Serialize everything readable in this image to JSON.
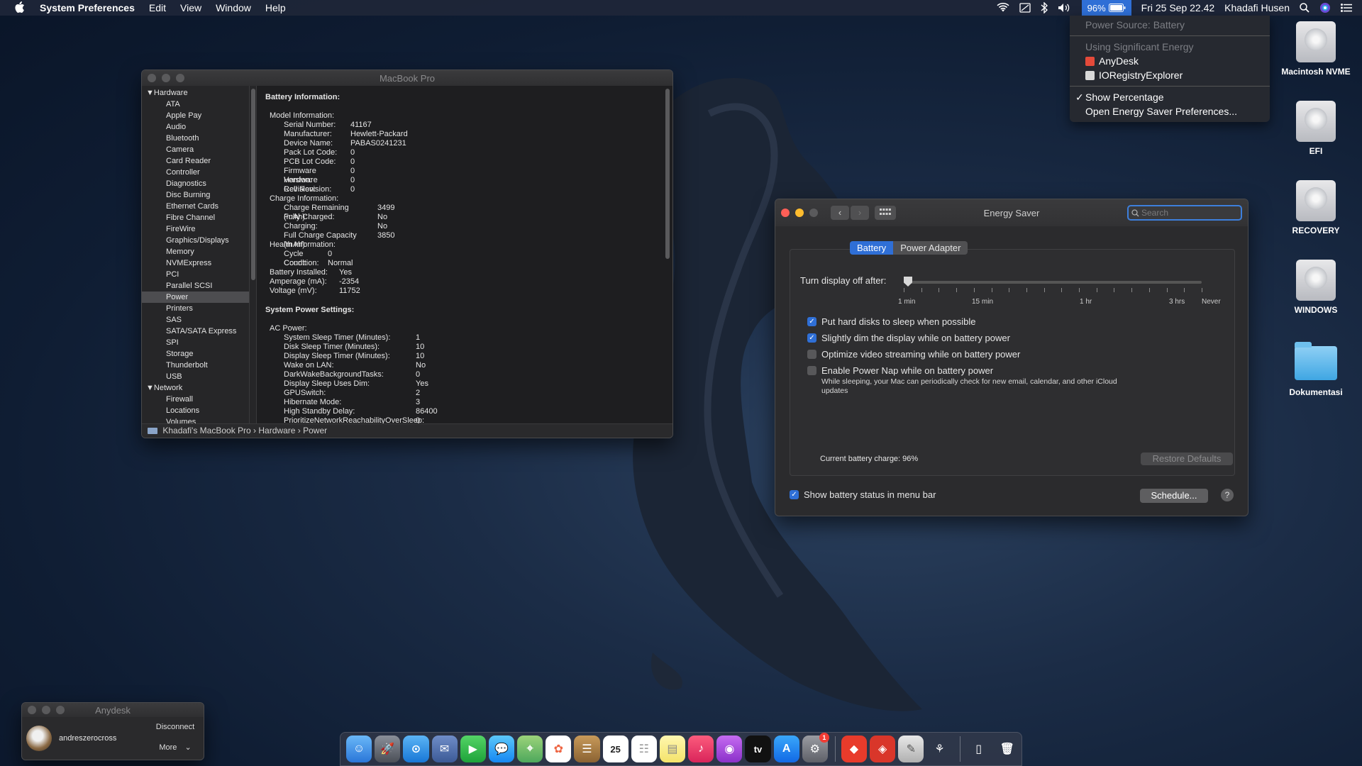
{
  "menubar": {
    "app": "System Preferences",
    "menus": [
      "Edit",
      "View",
      "Window",
      "Help"
    ],
    "battery_percent": "96%",
    "datetime": "Fri 25 Sep  22.42",
    "user": "Khadafi Husen"
  },
  "battery_menu": {
    "power_source": "Power Source: Battery",
    "sig_energy_header": "Using Significant Energy",
    "apps": [
      "AnyDesk",
      "IORegistryExplorer"
    ],
    "show_percentage": "Show Percentage",
    "open_prefs": "Open Energy Saver Preferences..."
  },
  "desktop_icons": [
    "Macintosh NVME",
    "EFI",
    "RECOVERY",
    "WINDOWS",
    "Dokumentasi"
  ],
  "sysinfo": {
    "title": "MacBook Pro",
    "sidebar": {
      "hardware_label": "Hardware",
      "hardware_items": [
        "ATA",
        "Apple Pay",
        "Audio",
        "Bluetooth",
        "Camera",
        "Card Reader",
        "Controller",
        "Diagnostics",
        "Disc Burning",
        "Ethernet Cards",
        "Fibre Channel",
        "FireWire",
        "Graphics/Displays",
        "Memory",
        "NVMExpress",
        "PCI",
        "Parallel SCSI",
        "Power",
        "Printers",
        "SAS",
        "SATA/SATA Express",
        "SPI",
        "Storage",
        "Thunderbolt",
        "USB"
      ],
      "network_label": "Network",
      "network_items": [
        "Firewall",
        "Locations",
        "Volumes"
      ]
    },
    "battery_info_title": "Battery Information:",
    "model_info_label": "Model Information:",
    "model_rows": [
      [
        "Serial Number:",
        "41167"
      ],
      [
        "Manufacturer:",
        "Hewlett-Packard"
      ],
      [
        "Device Name:",
        "PABAS0241231"
      ],
      [
        "Pack Lot Code:",
        "0"
      ],
      [
        "PCB Lot Code:",
        "0"
      ],
      [
        "Firmware Version:",
        "0"
      ],
      [
        "Hardware Revision:",
        "0"
      ],
      [
        "Cell Revision:",
        "0"
      ]
    ],
    "charge_info_label": "Charge Information:",
    "charge_rows": [
      [
        "Charge Remaining (mAh):",
        "3499"
      ],
      [
        "Fully Charged:",
        "No"
      ],
      [
        "Charging:",
        "No"
      ],
      [
        "Full Charge Capacity (mAh):",
        "3850"
      ]
    ],
    "health_info_label": "Health Information:",
    "health_rows": [
      [
        "Cycle Count:",
        "0"
      ],
      [
        "Condition:",
        "Normal"
      ]
    ],
    "misc_rows": [
      [
        "Battery Installed:",
        "Yes"
      ],
      [
        "Amperage (mA):",
        "-2354"
      ],
      [
        "Voltage (mV):",
        "11752"
      ]
    ],
    "power_settings_title": "System Power Settings:",
    "ac_power_label": "AC Power:",
    "ac_rows": [
      [
        "System Sleep Timer (Minutes):",
        "1"
      ],
      [
        "Disk Sleep Timer (Minutes):",
        "10"
      ],
      [
        "Display Sleep Timer (Minutes):",
        "10"
      ],
      [
        "Wake on LAN:",
        "No"
      ],
      [
        "DarkWakeBackgroundTasks:",
        "0"
      ],
      [
        "Display Sleep Uses Dim:",
        "Yes"
      ],
      [
        "GPUSwitch:",
        "2"
      ],
      [
        "Hibernate Mode:",
        "3"
      ],
      [
        "High Standby Delay:",
        "86400"
      ],
      [
        "PrioritizeNetworkReachabilityOverSleep:",
        "0"
      ]
    ],
    "path": [
      "Khadafi's MacBook Pro",
      "Hardware",
      "Power"
    ]
  },
  "energy": {
    "title": "Energy Saver",
    "search_placeholder": "Search",
    "tabs": [
      "Battery",
      "Power Adapter"
    ],
    "slider_label": "Turn display off after:",
    "slider_ticks": [
      "1 min",
      "15 min",
      "1 hr",
      "3 hrs",
      "Never"
    ],
    "slider_value_fraction": 0.0,
    "options": [
      {
        "label": "Put hard disks to sleep when possible",
        "checked": true
      },
      {
        "label": "Slightly dim the display while on battery power",
        "checked": true
      },
      {
        "label": "Optimize video streaming while on battery power",
        "checked": false
      },
      {
        "label": "Enable Power Nap while on battery power",
        "checked": false
      }
    ],
    "power_nap_desc": "While sleeping, your Mac can periodically check for new email, calendar, and other iCloud updates",
    "current_charge": "Current battery charge: 96%",
    "restore_defaults": "Restore Defaults",
    "show_status": "Show battery status in menu bar",
    "schedule": "Schedule...",
    "help": "?"
  },
  "anydesk": {
    "title": "Anydesk",
    "user": "andreszerocross",
    "disconnect": "Disconnect",
    "more": "More"
  },
  "dock": {
    "calendar_day": "25",
    "prefs_badge": "1",
    "tv_label": "tv"
  }
}
